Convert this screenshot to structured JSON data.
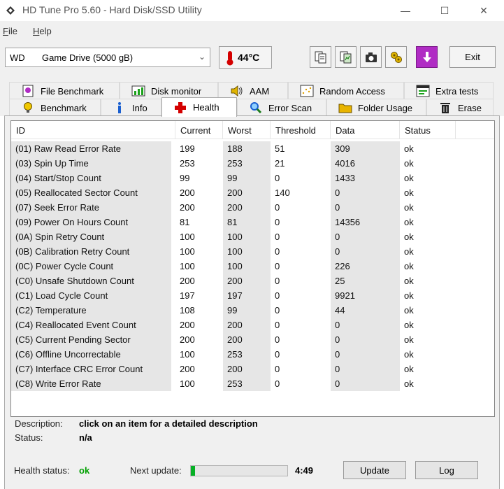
{
  "window": {
    "title": "HD Tune Pro 5.60 - Hard Disk/SSD Utility",
    "minimize_glyph": "—",
    "maximize_glyph": "☐",
    "close_glyph": "✕"
  },
  "menu": {
    "file_first": "F",
    "file_rest": "ile",
    "help_first": "H",
    "help_rest": "elp"
  },
  "toolbar": {
    "drive_brand": "WD",
    "drive_name": "Game Drive (5000 gB)",
    "temperature": "44°C",
    "exit_label": "Exit",
    "icons": [
      "copy-text-icon",
      "copy-all-icon",
      "screenshot-icon",
      "options-icon",
      "save-icon"
    ]
  },
  "tabs": {
    "row1": [
      "File Benchmark",
      "Disk monitor",
      "AAM",
      "Random Access",
      "Extra tests"
    ],
    "row2": [
      "Benchmark",
      "Info",
      "Health",
      "Error Scan",
      "Folder Usage",
      "Erase"
    ],
    "active": "Health"
  },
  "table": {
    "columns": [
      "ID",
      "Current",
      "Worst",
      "Threshold",
      "Data",
      "Status"
    ],
    "rows": [
      [
        "(01) Raw Read Error Rate",
        "199",
        "188",
        "51",
        "309",
        "ok"
      ],
      [
        "(03) Spin Up Time",
        "253",
        "253",
        "21",
        "4016",
        "ok"
      ],
      [
        "(04) Start/Stop Count",
        "99",
        "99",
        "0",
        "1433",
        "ok"
      ],
      [
        "(05) Reallocated Sector Count",
        "200",
        "200",
        "140",
        "0",
        "ok"
      ],
      [
        "(07) Seek Error Rate",
        "200",
        "200",
        "0",
        "0",
        "ok"
      ],
      [
        "(09) Power On Hours Count",
        "81",
        "81",
        "0",
        "14356",
        "ok"
      ],
      [
        "(0A) Spin Retry Count",
        "100",
        "100",
        "0",
        "0",
        "ok"
      ],
      [
        "(0B) Calibration Retry Count",
        "100",
        "100",
        "0",
        "0",
        "ok"
      ],
      [
        "(0C) Power Cycle Count",
        "100",
        "100",
        "0",
        "226",
        "ok"
      ],
      [
        "(C0) Unsafe Shutdown Count",
        "200",
        "200",
        "0",
        "25",
        "ok"
      ],
      [
        "(C1) Load Cycle Count",
        "197",
        "197",
        "0",
        "9921",
        "ok"
      ],
      [
        "(C2) Temperature",
        "108",
        "99",
        "0",
        "44",
        "ok"
      ],
      [
        "(C4) Reallocated Event Count",
        "200",
        "200",
        "0",
        "0",
        "ok"
      ],
      [
        "(C5) Current Pending Sector",
        "200",
        "200",
        "0",
        "0",
        "ok"
      ],
      [
        "(C6) Offline Uncorrectable",
        "100",
        "253",
        "0",
        "0",
        "ok"
      ],
      [
        "(C7) Interface CRC Error Count",
        "200",
        "200",
        "0",
        "0",
        "ok"
      ],
      [
        "(C8) Write Error Rate",
        "100",
        "253",
        "0",
        "0",
        "ok"
      ]
    ]
  },
  "details": {
    "description_label": "Description:",
    "description_value": "click on an item for a detailed description",
    "status_label": "Status:",
    "status_value": "n/a"
  },
  "footer": {
    "health_label": "Health status:",
    "health_value": "ok",
    "next_update_label": "Next update:",
    "progress_fraction": 0.04,
    "countdown": "4:49",
    "update_label": "Update",
    "log_label": "Log"
  },
  "colors": {
    "health_ok": "#00a000",
    "progress": "#06b025",
    "shaded_column": "#e6e6e6"
  }
}
